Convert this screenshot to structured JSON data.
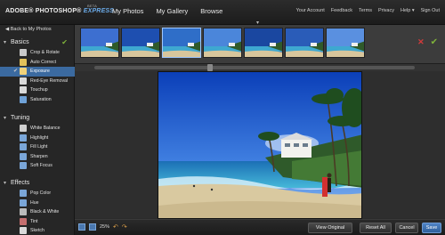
{
  "header": {
    "logo_main": "ADOBE® PHOTOSHOP®",
    "logo_express": "EXPRESS",
    "logo_beta": "BETA",
    "nav": [
      "My Photos",
      "My Gallery",
      "Browse"
    ],
    "links": [
      "Your Account",
      "Feedback",
      "Terms",
      "Privacy",
      "Help ▾",
      "Sign Out"
    ]
  },
  "sidebar": {
    "back_label": "Back to My Photos",
    "sections": [
      {
        "title": "Basics",
        "tools": [
          {
            "label": "Crop & Rotate",
            "icon": "crop-icon",
            "color": "#c9c9c9"
          },
          {
            "label": "Auto Correct",
            "icon": "auto-correct-icon",
            "color": "#e2c15a"
          },
          {
            "label": "Exposure",
            "icon": "exposure-icon",
            "color": "#f0d27a",
            "active": true,
            "checked": true
          },
          {
            "label": "Red-Eye Removal",
            "icon": "red-eye-icon",
            "color": "#d9d9d9"
          },
          {
            "label": "Touchup",
            "icon": "touchup-icon",
            "color": "#d9d9d9"
          },
          {
            "label": "Saturation",
            "icon": "saturation-icon",
            "color": "#6fa2d8"
          }
        ]
      },
      {
        "title": "Tuning",
        "tools": [
          {
            "label": "White Balance",
            "icon": "white-balance-icon",
            "color": "#cfcfcf"
          },
          {
            "label": "Highlight",
            "icon": "highlight-icon",
            "color": "#7aa6d8"
          },
          {
            "label": "Fill Light",
            "icon": "fill-light-icon",
            "color": "#7aa6d8"
          },
          {
            "label": "Sharpen",
            "icon": "sharpen-icon",
            "color": "#7aa6d8"
          },
          {
            "label": "Soft Focus",
            "icon": "soft-focus-icon",
            "color": "#7aa6d8"
          }
        ]
      },
      {
        "title": "Effects",
        "tools": [
          {
            "label": "Pop Color",
            "icon": "pop-color-icon",
            "color": "#7aa6d8"
          },
          {
            "label": "Hue",
            "icon": "hue-icon",
            "color": "#7aa6d8"
          },
          {
            "label": "Black & White",
            "icon": "black-white-icon",
            "color": "#bbbbbb"
          },
          {
            "label": "Tint",
            "icon": "tint-icon",
            "color": "#c46e6e"
          },
          {
            "label": "Sketch",
            "icon": "sketch-icon",
            "color": "#d9d9d9"
          }
        ]
      }
    ]
  },
  "strip": {
    "selected_index": 2,
    "thumb_count": 7,
    "slider_level": 0.36
  },
  "bottom": {
    "zoom": "25%",
    "view_original": "View Original",
    "reset_all": "Reset All",
    "cancel": "Cancel",
    "save": "Save"
  },
  "colors": {
    "accent": "#3b6aa0",
    "confirm": "#7fb33a",
    "reject": "#d23b3b"
  }
}
